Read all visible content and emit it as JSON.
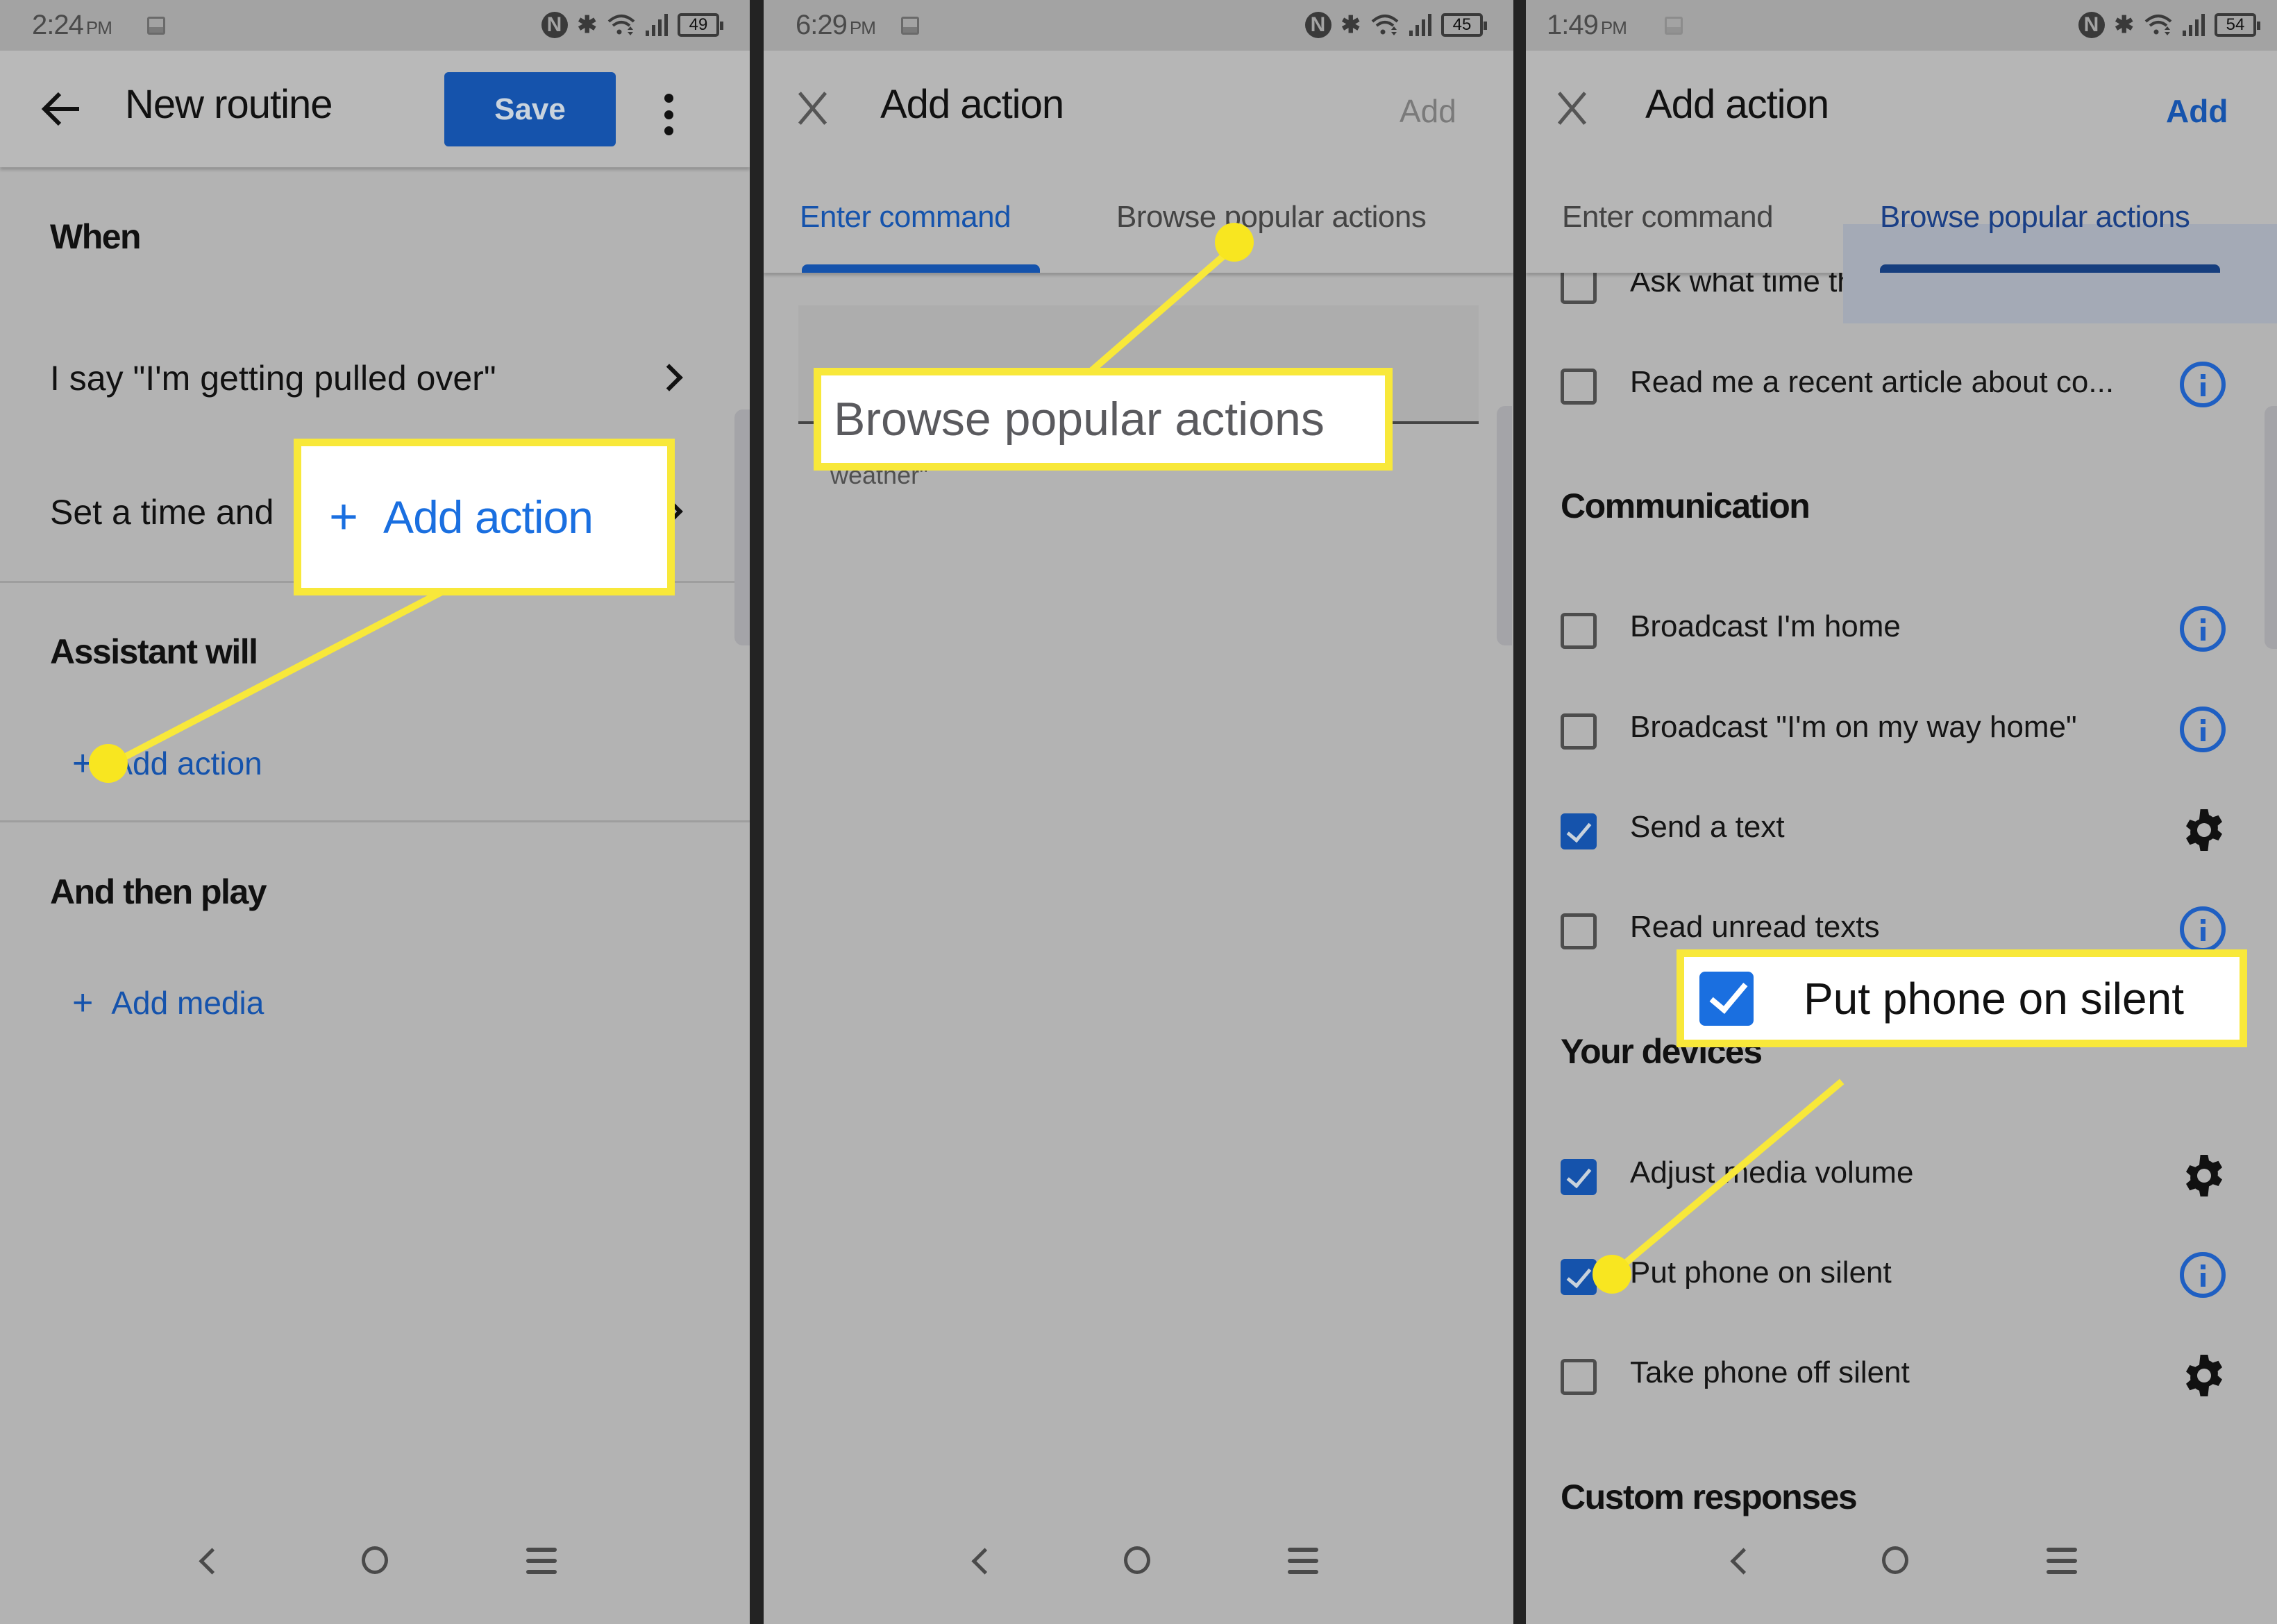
{
  "colors": {
    "accent_blue": "#1553ac",
    "callout_yellow": "#f8e83a",
    "screen_gray": "#b3b3b3"
  },
  "panels": [
    {
      "status": {
        "time": "2:24",
        "ampm": "PM",
        "battery": "49",
        "icons": [
          "gallery-icon",
          "nfc-icon",
          "bluetooth-icon",
          "wifi-icon",
          "signal-icon",
          "battery-icon"
        ]
      },
      "appbar": {
        "back_icon": "arrow-left-icon",
        "title": "New routine",
        "save_label": "Save",
        "more_icon": "more-vert-icon"
      },
      "sections": {
        "when_title": "When",
        "trigger_voice": "I say \"I'm getting pulled over\"",
        "trigger_time": "Set a time and",
        "assistant_title": "Assistant will",
        "add_action_label": "Add action",
        "then_title": "And then play",
        "add_media_label": "Add media"
      },
      "callout": {
        "label": "Add action"
      }
    },
    {
      "status": {
        "time": "6:29",
        "ampm": "PM",
        "battery": "45"
      },
      "appbar": {
        "close_icon": "close-icon",
        "title": "Add action",
        "add_label": "Add",
        "add_enabled": false
      },
      "tabs": [
        {
          "label": "Enter command",
          "active": true
        },
        {
          "label": "Browse popular actions",
          "active": false
        }
      ],
      "input_hint_tail": "weather\"",
      "callout": {
        "label": "Browse popular actions"
      }
    },
    {
      "status": {
        "time": "1:49",
        "ampm": "PM",
        "battery": "54"
      },
      "appbar": {
        "close_icon": "close-icon",
        "title": "Add action",
        "add_label": "Add",
        "add_enabled": true
      },
      "tabs": [
        {
          "label": "Enter command",
          "active": false
        },
        {
          "label": "Browse popular actions",
          "active": true
        }
      ],
      "items_top": [
        {
          "label": "Ask what time the alarm should b...",
          "checked": false,
          "icon": "gear"
        },
        {
          "label": "Read me a recent article about co...",
          "checked": false,
          "icon": "info"
        }
      ],
      "communication": {
        "title": "Communication",
        "items": [
          {
            "label": "Broadcast I'm home",
            "checked": false,
            "icon": "info"
          },
          {
            "label": "Broadcast \"I'm on my way home\"",
            "checked": false,
            "icon": "info"
          },
          {
            "label": "Send a text",
            "checked": true,
            "icon": "gear"
          },
          {
            "label": "Read unread texts",
            "checked": false,
            "icon": "info"
          }
        ]
      },
      "devices": {
        "title": "Your devices",
        "items": [
          {
            "label": "Adjust media volume",
            "checked": true,
            "icon": "gear"
          },
          {
            "label": "Put phone on silent",
            "checked": true,
            "icon": "info"
          },
          {
            "label": "Take phone off silent",
            "checked": false,
            "icon": "gear"
          }
        ]
      },
      "custom_title": "Custom responses",
      "callout": {
        "label": "Put phone on silent",
        "checked": true
      }
    }
  ],
  "navbar": {
    "back": "nav-back-icon",
    "home": "nav-home-icon",
    "recents": "nav-recents-icon"
  }
}
